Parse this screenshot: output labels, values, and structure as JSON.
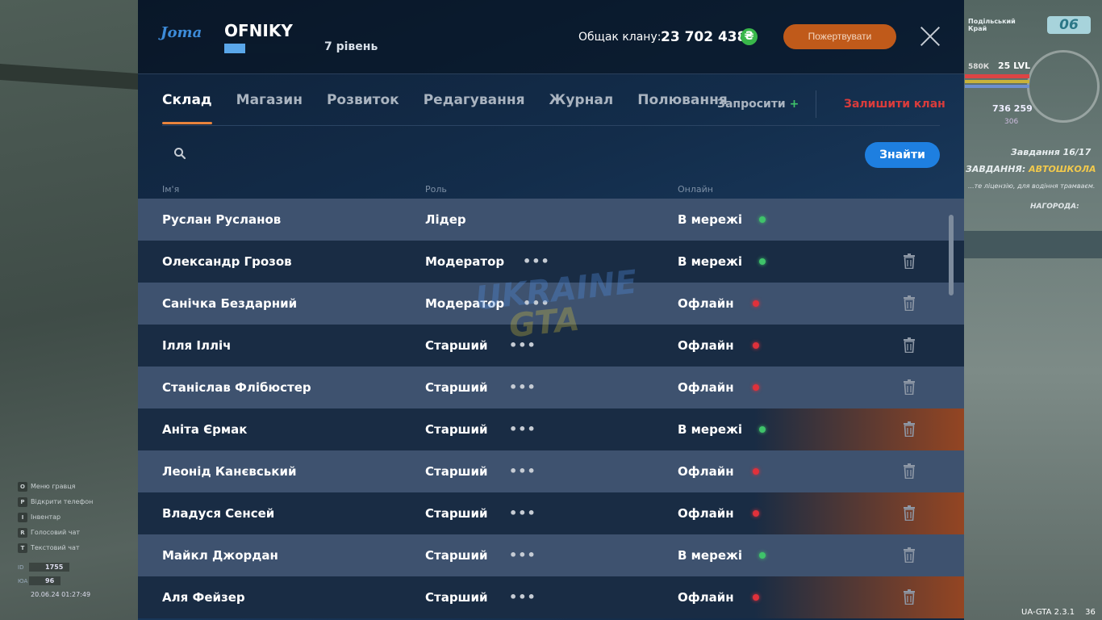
{
  "header": {
    "logo": "Joma",
    "clan_name": "OFNIKY",
    "level_text": "7 рівень",
    "level_progress": 0.23,
    "total_label": "Общак клану:",
    "total_value": "23 702 438",
    "currency_symbol": "₴",
    "donate_label": "Пожертвувати"
  },
  "tabs": [
    {
      "label": "Склад",
      "active": true
    },
    {
      "label": "Магазин",
      "active": false
    },
    {
      "label": "Розвиток",
      "active": false
    },
    {
      "label": "Редагування",
      "active": false
    },
    {
      "label": "Журнал",
      "active": false
    },
    {
      "label": "Полювання",
      "active": false
    }
  ],
  "actions": {
    "invite_label": "Запросити",
    "invite_plus": "+",
    "leave_label": "Залишити клан"
  },
  "search": {
    "placeholder": "",
    "button_label": "Знайти"
  },
  "columns": {
    "name": "Ім'я",
    "role": "Роль",
    "online": "Онлайн"
  },
  "members": [
    {
      "name": "Руслан Русланов",
      "role": "Лідер",
      "status": "В мережі",
      "online": true,
      "menu": false,
      "delete": false,
      "highlight": false
    },
    {
      "name": "Олександр Грозов",
      "role": "Модератор",
      "status": "В мережі",
      "online": true,
      "menu": true,
      "delete": true,
      "highlight": false
    },
    {
      "name": "Санічка Бездарний",
      "role": "Модератор",
      "status": "Офлайн",
      "online": false,
      "menu": true,
      "delete": true,
      "highlight": false
    },
    {
      "name": "Ілля Ілліч",
      "role": "Старший",
      "status": "Офлайн",
      "online": false,
      "menu": true,
      "delete": true,
      "highlight": false
    },
    {
      "name": "Станіслав Флібюстер",
      "role": "Старший",
      "status": "Офлайн",
      "online": false,
      "menu": true,
      "delete": true,
      "highlight": false
    },
    {
      "name": "Аніта Єрмак",
      "role": "Старший",
      "status": "В мережі",
      "online": true,
      "menu": true,
      "delete": true,
      "highlight": true
    },
    {
      "name": "Леонід Канєвський",
      "role": "Старший",
      "status": "Офлайн",
      "online": false,
      "menu": true,
      "delete": true,
      "highlight": false
    },
    {
      "name": "Владуся Сенсей",
      "role": "Старший",
      "status": "Офлайн",
      "online": false,
      "menu": true,
      "delete": true,
      "highlight": true
    },
    {
      "name": "Майкл Джордан",
      "role": "Старший",
      "status": "В мережі",
      "online": true,
      "menu": true,
      "delete": true,
      "highlight": false
    },
    {
      "name": "Аля Фейзер",
      "role": "Старший",
      "status": "Офлайн",
      "online": false,
      "menu": true,
      "delete": true,
      "highlight": true
    }
  ],
  "watermark": {
    "line1": "UKRAINE",
    "line2": "GTA"
  },
  "hud": {
    "region": "Подільський Край",
    "region_number": "06",
    "money": "580К",
    "level": "25 LVL",
    "cash": "736 259",
    "coins": "306",
    "quest_title": "Завдання 16/17",
    "quest_label": "ЗАВДАННЯ:",
    "quest_name": "АВТОШКОЛА",
    "quest_desc": "...те ліцензію, для водіння трамваєм.",
    "reward": "НАГОРОДА:",
    "left_menu": [
      {
        "key": "O",
        "label": "Меню гравця"
      },
      {
        "key": "P",
        "label": "Відкрити телефон"
      },
      {
        "key": "I",
        "label": "Інвентар"
      },
      {
        "key": "R",
        "label": "Голосовий чат"
      },
      {
        "key": "T",
        "label": "Текстовий чат"
      }
    ],
    "stats": [
      {
        "label": "ID",
        "value": "1755"
      },
      {
        "label": "ЮА",
        "value": "96"
      }
    ],
    "datetime": "20.06.24 01:27:49",
    "version": "UA-GTA 2.3.1",
    "edge": "36"
  },
  "colors": {
    "accent_orange": "#e8833c",
    "button_blue": "#1e7fe0",
    "online_green": "#3fc36a",
    "offline_red": "#e0313b",
    "leave_red": "#d93c3c"
  }
}
